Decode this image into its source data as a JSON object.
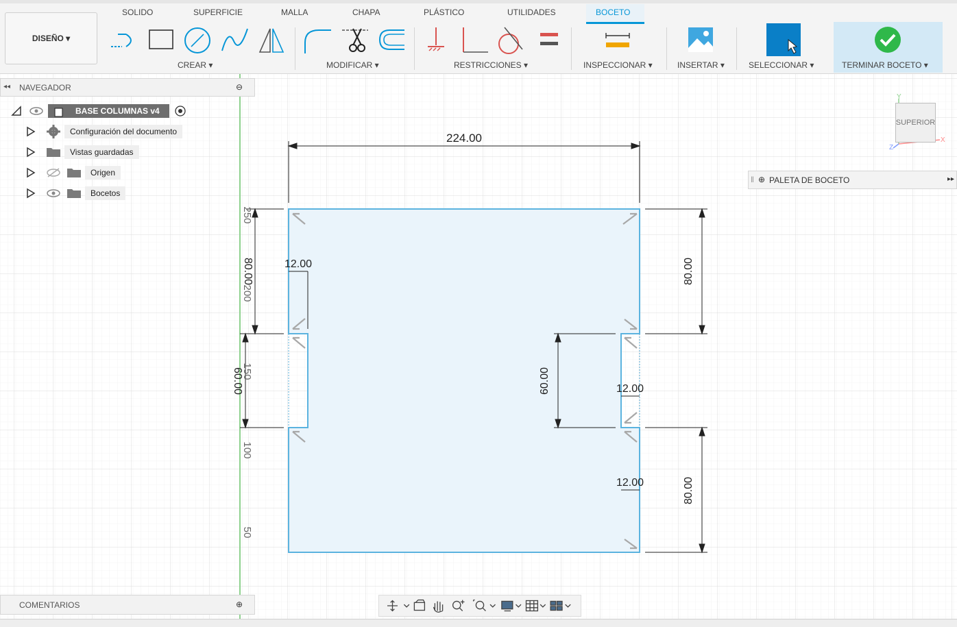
{
  "design_button": "DISEÑO ▾",
  "tabs": [
    "SOLIDO",
    "SUPERFICIE",
    "MALLA",
    "CHAPA",
    "PLÁSTICO",
    "UTILIDADES",
    "BOCETO"
  ],
  "groups": {
    "create": "CREAR ▾",
    "modify": "MODIFICAR ▾",
    "constraints": "RESTRICCIONES ▾",
    "inspect": "INSPECCIONAR ▾",
    "insert": "INSERTAR ▾",
    "select": "SELECCIONAR ▾",
    "finish": "TERMINAR BOCETO ▾"
  },
  "browser": {
    "title": "NAVEGADOR",
    "root": "BASE COLUMNAS v4",
    "items": [
      "Configuración del documento",
      "Vistas guardadas",
      "Origen",
      "Bocetos"
    ]
  },
  "comments": "COMENTARIOS",
  "palette": "PALETA DE BOCETO",
  "viewcube": {
    "face": "SUPERIOR",
    "axis_x": "X",
    "axis_y": "Y",
    "axis_z": "Z"
  },
  "dimensions": {
    "width": "224.00",
    "left_notch_depth": "12.00",
    "left_top_height": "80.00",
    "left_notch_height": "60.00",
    "right_notch_height": "60.00",
    "right_notch_depth": "12.00",
    "right_bottom_notch_depth": "12.00",
    "right_top_height": "80.00",
    "right_bottom_height": "80.00"
  },
  "ruler": [
    "250",
    "200",
    "150",
    "100",
    "50"
  ],
  "colors": {
    "accent": "#0696d7",
    "sketch_line": "#5bb3df",
    "sketch_fill": "#eaf4fb",
    "finish_green": "#2fb84a"
  }
}
